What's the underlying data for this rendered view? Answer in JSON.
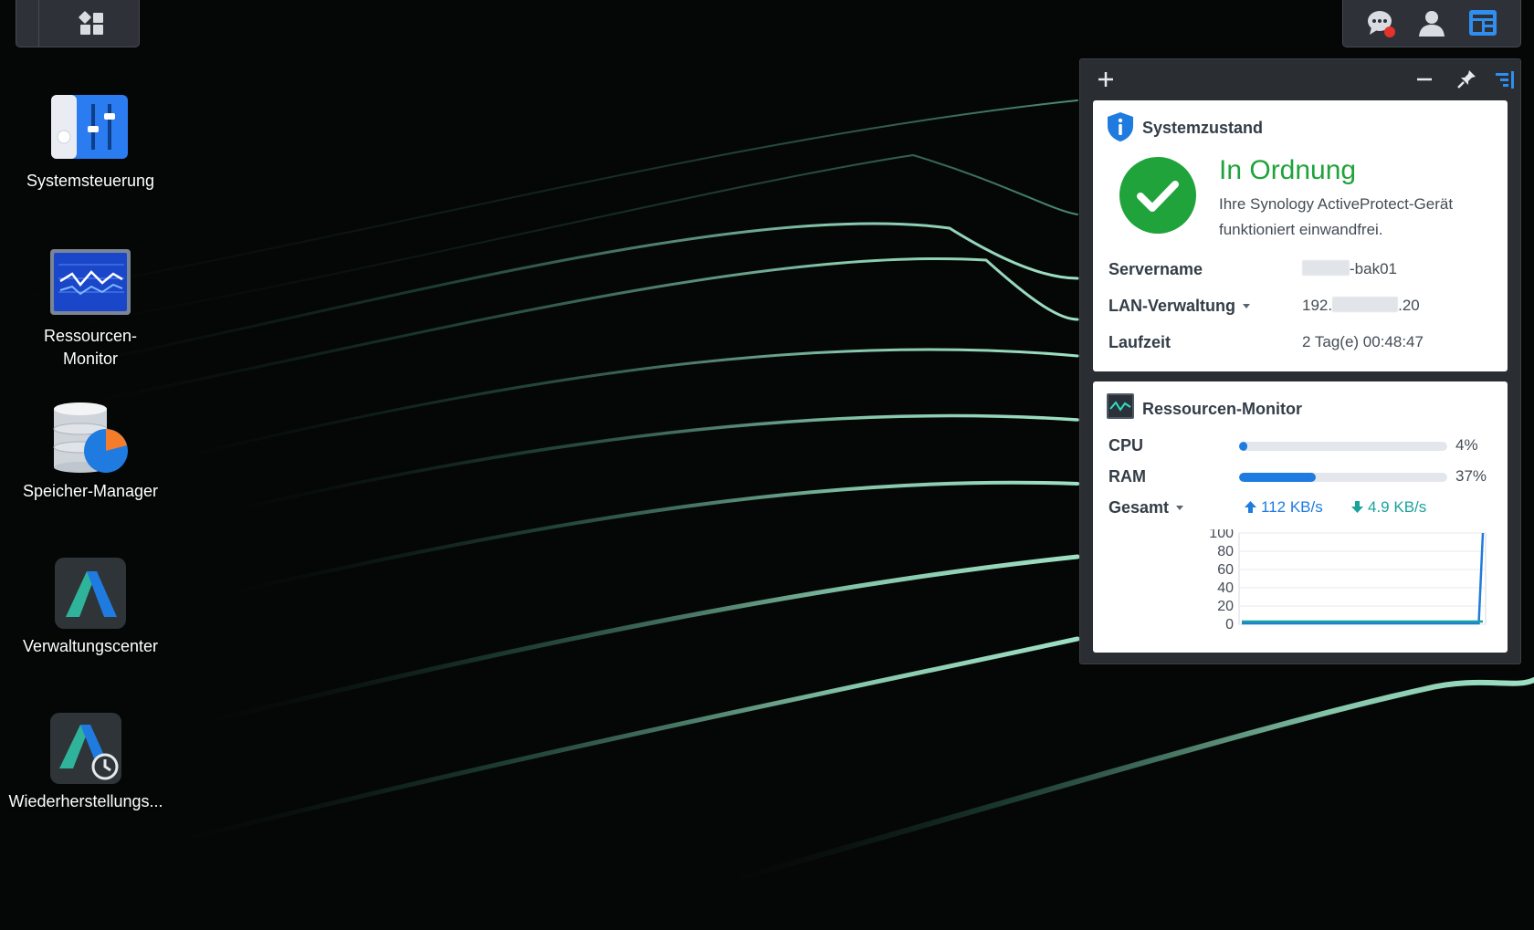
{
  "taskbar": {
    "main_menu_icon": "grid-icon",
    "tray": [
      {
        "name": "notifications-icon",
        "has_badge": true,
        "badge_color": "#e5322d"
      },
      {
        "name": "user-icon"
      },
      {
        "name": "widgets-icon",
        "color": "#2f8ef0"
      }
    ]
  },
  "desktop": {
    "icons": [
      {
        "label": "Systemsteuerung",
        "icon": "control-panel-icon"
      },
      {
        "label": "Ressourcen-\nMonitor",
        "icon": "resource-monitor-icon"
      },
      {
        "label": "Speicher-Manager",
        "icon": "storage-manager-icon"
      },
      {
        "label": "Verwaltungscenter",
        "icon": "management-center-icon"
      },
      {
        "label": "Wiederherstellungs...",
        "icon": "restore-portal-icon"
      }
    ]
  },
  "widgets": {
    "header_buttons": [
      "add-icon",
      "minimize-icon",
      "pin-icon",
      "widget-layout-icon"
    ],
    "system_health": {
      "title": "Systemzustand",
      "status": "In Ordnung",
      "description": "Ihre Synology ActiveProtect-Gerät funktioniert einwandfrei.",
      "status_color": "#1fa33a",
      "rows": [
        {
          "label": "Servername",
          "value_suffix": "-bak01"
        },
        {
          "label": "LAN-Verwaltung",
          "value_prefix": "192.",
          "value_suffix": ".20"
        },
        {
          "label": "Laufzeit",
          "value": "2 Tag(e) 00:48:47"
        }
      ]
    },
    "resource_monitor": {
      "title": "Ressourcen-Monitor",
      "cpu": {
        "label": "CPU",
        "value_text": "4%",
        "value": 0.04
      },
      "ram": {
        "label": "RAM",
        "value_text": "37%",
        "value": 0.37
      },
      "network": {
        "label": "Gesamt",
        "upload": "112 KB/s",
        "download": "4.9 KB/s"
      },
      "bar_color": "#1f7be0"
    }
  },
  "chart_data": {
    "type": "line",
    "ylim": [
      0,
      100
    ],
    "yticks": [
      "100",
      "80",
      "60",
      "40",
      "20",
      "0"
    ],
    "series": [
      {
        "color": "#1f7be0",
        "values": [
          1,
          1,
          1,
          1,
          1,
          1,
          1,
          1,
          1,
          1,
          1,
          1,
          1,
          1,
          1,
          1,
          1,
          1,
          1,
          1,
          1,
          1,
          1,
          1,
          1,
          1,
          1,
          1,
          1,
          1,
          1,
          1,
          1,
          1,
          1,
          1,
          1,
          1,
          1,
          1,
          1,
          1,
          1,
          1,
          1,
          1,
          1,
          1,
          1,
          1,
          1,
          1,
          1,
          1,
          1,
          1,
          1,
          1,
          1,
          100
        ]
      },
      {
        "color": "#1aa29b",
        "values": [
          3,
          3,
          3,
          3,
          3,
          3,
          3,
          3,
          3,
          3,
          3,
          3,
          3,
          3,
          3,
          3,
          3,
          3,
          3,
          3,
          3,
          3,
          3,
          3,
          3,
          3,
          3,
          3,
          3,
          3,
          3,
          3,
          3,
          3,
          3,
          3,
          3,
          3,
          3,
          3,
          3,
          3,
          3,
          3,
          3,
          3,
          3,
          3,
          3,
          3,
          3,
          3,
          3,
          3,
          3,
          3,
          3,
          3,
          3,
          3
        ]
      }
    ]
  }
}
